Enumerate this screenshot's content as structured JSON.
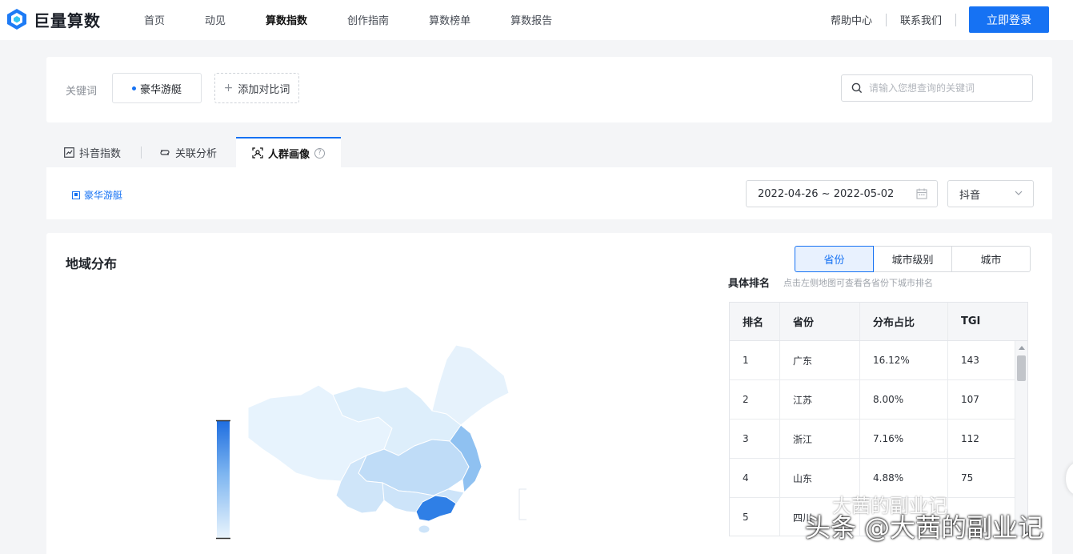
{
  "brand": {
    "name": "巨量算数",
    "accent": "#1672f3"
  },
  "nav": {
    "items": [
      "首页",
      "动见",
      "算数指数",
      "创作指南",
      "算数榜单",
      "算数报告"
    ],
    "active": "算数指数"
  },
  "header": {
    "help": "帮助中心",
    "contact": "联系我们",
    "login": "立即登录"
  },
  "keyword": {
    "label": "关键词",
    "current": "豪华游艇",
    "add_compare": "添加对比词",
    "search_placeholder": "请输入您想查询的关键词"
  },
  "tabs": {
    "douyin_index": "抖音指数",
    "related": "关联分析",
    "crowd": "人群画像"
  },
  "filter": {
    "legend_keyword": "豪华游艇",
    "date_range": "2022-04-26 ~ 2022-05-02",
    "platform": "抖音"
  },
  "region": {
    "title": "地域分布",
    "segments": [
      "省份",
      "城市级别",
      "城市"
    ],
    "active_segment": "省份",
    "rank_title": "具体排名",
    "rank_hint": "点击左侧地图可查看各省份下城市排名",
    "columns": [
      "排名",
      "省份",
      "分布占比",
      "TGI"
    ],
    "rows": [
      {
        "rank": "1",
        "province": "广东",
        "share": "16.12%",
        "tgi": "143"
      },
      {
        "rank": "2",
        "province": "江苏",
        "share": "8.00%",
        "tgi": "107"
      },
      {
        "rank": "3",
        "province": "浙江",
        "share": "7.16%",
        "tgi": "112"
      },
      {
        "rank": "4",
        "province": "山东",
        "share": "4.88%",
        "tgi": "75"
      },
      {
        "rank": "5",
        "province": "四川",
        "share": "",
        "tgi": ""
      }
    ]
  },
  "watermark": {
    "small": "大茜的副业记",
    "large": "头条 @大茜的副业记"
  }
}
